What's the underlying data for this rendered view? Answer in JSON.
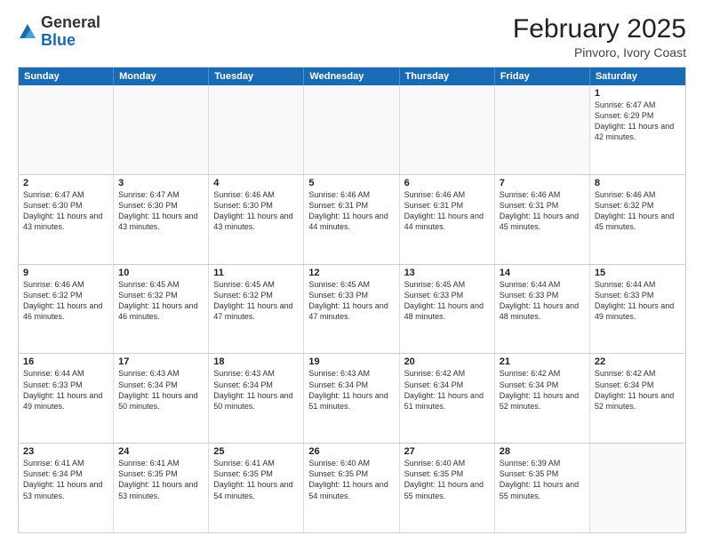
{
  "header": {
    "logo": {
      "line1": "General",
      "line2": "Blue"
    },
    "title": "February 2025",
    "location": "Pinvoro, Ivory Coast"
  },
  "days": [
    "Sunday",
    "Monday",
    "Tuesday",
    "Wednesday",
    "Thursday",
    "Friday",
    "Saturday"
  ],
  "weeks": [
    [
      {
        "day": "",
        "text": "",
        "empty": true
      },
      {
        "day": "",
        "text": "",
        "empty": true
      },
      {
        "day": "",
        "text": "",
        "empty": true
      },
      {
        "day": "",
        "text": "",
        "empty": true
      },
      {
        "day": "",
        "text": "",
        "empty": true
      },
      {
        "day": "",
        "text": "",
        "empty": true
      },
      {
        "day": "1",
        "text": "Sunrise: 6:47 AM\nSunset: 6:29 PM\nDaylight: 11 hours and 42 minutes."
      }
    ],
    [
      {
        "day": "2",
        "text": "Sunrise: 6:47 AM\nSunset: 6:30 PM\nDaylight: 11 hours and 43 minutes."
      },
      {
        "day": "3",
        "text": "Sunrise: 6:47 AM\nSunset: 6:30 PM\nDaylight: 11 hours and 43 minutes."
      },
      {
        "day": "4",
        "text": "Sunrise: 6:46 AM\nSunset: 6:30 PM\nDaylight: 11 hours and 43 minutes."
      },
      {
        "day": "5",
        "text": "Sunrise: 6:46 AM\nSunset: 6:31 PM\nDaylight: 11 hours and 44 minutes."
      },
      {
        "day": "6",
        "text": "Sunrise: 6:46 AM\nSunset: 6:31 PM\nDaylight: 11 hours and 44 minutes."
      },
      {
        "day": "7",
        "text": "Sunrise: 6:46 AM\nSunset: 6:31 PM\nDaylight: 11 hours and 45 minutes."
      },
      {
        "day": "8",
        "text": "Sunrise: 6:46 AM\nSunset: 6:32 PM\nDaylight: 11 hours and 45 minutes."
      }
    ],
    [
      {
        "day": "9",
        "text": "Sunrise: 6:46 AM\nSunset: 6:32 PM\nDaylight: 11 hours and 46 minutes."
      },
      {
        "day": "10",
        "text": "Sunrise: 6:45 AM\nSunset: 6:32 PM\nDaylight: 11 hours and 46 minutes."
      },
      {
        "day": "11",
        "text": "Sunrise: 6:45 AM\nSunset: 6:32 PM\nDaylight: 11 hours and 47 minutes."
      },
      {
        "day": "12",
        "text": "Sunrise: 6:45 AM\nSunset: 6:33 PM\nDaylight: 11 hours and 47 minutes."
      },
      {
        "day": "13",
        "text": "Sunrise: 6:45 AM\nSunset: 6:33 PM\nDaylight: 11 hours and 48 minutes."
      },
      {
        "day": "14",
        "text": "Sunrise: 6:44 AM\nSunset: 6:33 PM\nDaylight: 11 hours and 48 minutes."
      },
      {
        "day": "15",
        "text": "Sunrise: 6:44 AM\nSunset: 6:33 PM\nDaylight: 11 hours and 49 minutes."
      }
    ],
    [
      {
        "day": "16",
        "text": "Sunrise: 6:44 AM\nSunset: 6:33 PM\nDaylight: 11 hours and 49 minutes."
      },
      {
        "day": "17",
        "text": "Sunrise: 6:43 AM\nSunset: 6:34 PM\nDaylight: 11 hours and 50 minutes."
      },
      {
        "day": "18",
        "text": "Sunrise: 6:43 AM\nSunset: 6:34 PM\nDaylight: 11 hours and 50 minutes."
      },
      {
        "day": "19",
        "text": "Sunrise: 6:43 AM\nSunset: 6:34 PM\nDaylight: 11 hours and 51 minutes."
      },
      {
        "day": "20",
        "text": "Sunrise: 6:42 AM\nSunset: 6:34 PM\nDaylight: 11 hours and 51 minutes."
      },
      {
        "day": "21",
        "text": "Sunrise: 6:42 AM\nSunset: 6:34 PM\nDaylight: 11 hours and 52 minutes."
      },
      {
        "day": "22",
        "text": "Sunrise: 6:42 AM\nSunset: 6:34 PM\nDaylight: 11 hours and 52 minutes."
      }
    ],
    [
      {
        "day": "23",
        "text": "Sunrise: 6:41 AM\nSunset: 6:34 PM\nDaylight: 11 hours and 53 minutes."
      },
      {
        "day": "24",
        "text": "Sunrise: 6:41 AM\nSunset: 6:35 PM\nDaylight: 11 hours and 53 minutes."
      },
      {
        "day": "25",
        "text": "Sunrise: 6:41 AM\nSunset: 6:35 PM\nDaylight: 11 hours and 54 minutes."
      },
      {
        "day": "26",
        "text": "Sunrise: 6:40 AM\nSunset: 6:35 PM\nDaylight: 11 hours and 54 minutes."
      },
      {
        "day": "27",
        "text": "Sunrise: 6:40 AM\nSunset: 6:35 PM\nDaylight: 11 hours and 55 minutes."
      },
      {
        "day": "28",
        "text": "Sunrise: 6:39 AM\nSunset: 6:35 PM\nDaylight: 11 hours and 55 minutes."
      },
      {
        "day": "",
        "text": "",
        "empty": true
      }
    ]
  ]
}
